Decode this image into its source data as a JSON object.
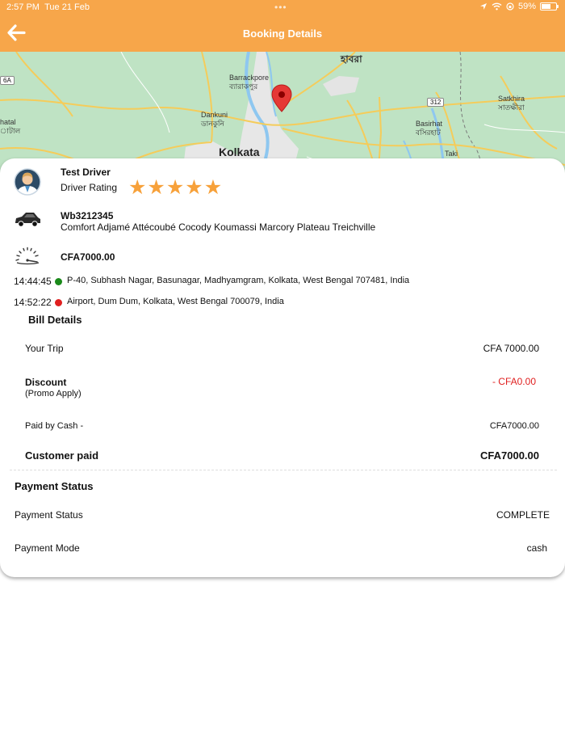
{
  "status_bar": {
    "time": "2:57 PM",
    "date": "Tue 21 Feb",
    "battery": "59%",
    "battery_level": 0.59
  },
  "header": {
    "title": "Booking Details",
    "back_icon": "arrow-left-icon"
  },
  "map": {
    "labels": {
      "howrah": "হাবরা",
      "barrackpore": "Barrackpore",
      "barrackpore_bn": "ব্যারাকপুর",
      "dankuni": "Dankuni",
      "dankuni_bn": "ডানকুনি",
      "kolkata": "Kolkata",
      "basirhat": "Basirhat",
      "basirhat_bn": "বসিরহাট",
      "satkhira": "Satkhira",
      "satkhira_bn": "সাতক্ষীরা",
      "taki": "Taki",
      "chatal": "hatal",
      "chatal_bn": "াটাল",
      "road_312": "312",
      "road_6a": "6A"
    }
  },
  "driver": {
    "name": "Test Driver",
    "rating_label": "Driver Rating",
    "rating": 5,
    "rating_max": 5,
    "star": "★"
  },
  "vehicle": {
    "plate": "Wb3212345",
    "description": "Comfort Adjamé Attécoubé Cocody Koumassi Marcory Plateau Treichville"
  },
  "fare": {
    "amount": "CFA7000.00"
  },
  "route": {
    "pickup_time": "14:44:45",
    "pickup_address": "P-40, Subhash Nagar, Basunagar, Madhyamgram, Kolkata, West Bengal 707481, India",
    "drop_time": "14:52:22",
    "drop_address": "Airport, Dum Dum, Kolkata, West Bengal 700079, India"
  },
  "bill": {
    "title": "Bill Details",
    "your_trip_label": "Your Trip",
    "your_trip_value": "CFA 7000.00",
    "discount_label": "Discount",
    "discount_sub": "(Promo Apply)",
    "discount_value": "- CFA0.00",
    "paid_by_cash_label": "Paid by Cash -",
    "paid_by_cash_value": "CFA7000.00",
    "customer_paid_label": "Customer paid",
    "customer_paid_value": "CFA7000.00"
  },
  "payment": {
    "title": "Payment Status",
    "status_label": "Payment Status",
    "status_value": "COMPLETE",
    "mode_label": "Payment Mode",
    "mode_value": "cash"
  },
  "colors": {
    "header": "#f7a64a",
    "star": "#f7a13a",
    "pickup_dot": "#1a8a1a",
    "drop_dot": "#e02020",
    "discount": "#e02020",
    "map_pin": "#e53935"
  }
}
